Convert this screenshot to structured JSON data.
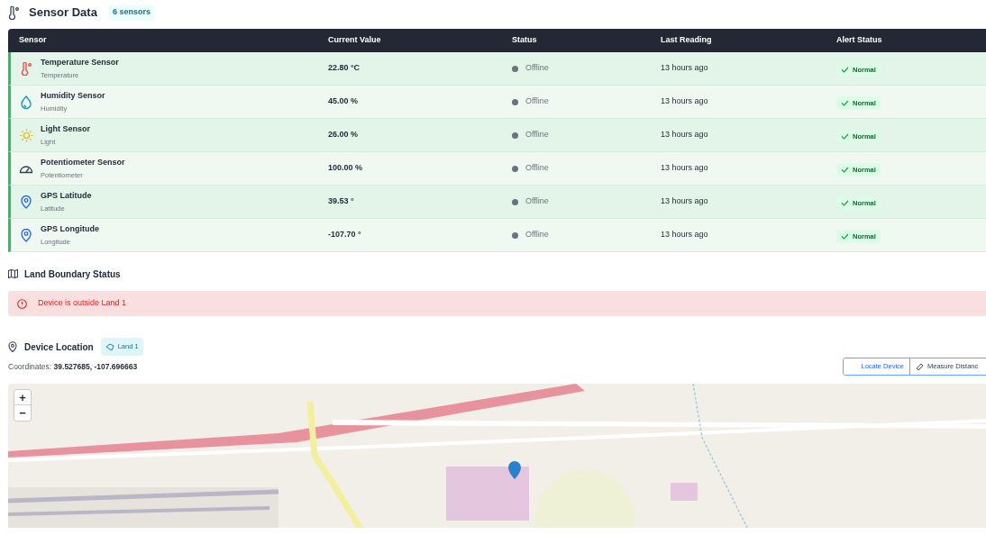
{
  "sensor_section": {
    "title": "Sensor Data",
    "count_badge": "6 sensors"
  },
  "table": {
    "columns": [
      "Sensor",
      "Current Value",
      "Status",
      "Last Reading",
      "Alert Status"
    ],
    "rows": [
      {
        "kind": "temperature",
        "name": "Temperature Sensor",
        "type": "Temperature",
        "value": "22.80 °C",
        "status": "Offline",
        "last_reading": "13 hours ago",
        "alert": "Normal"
      },
      {
        "kind": "humidity",
        "name": "Humidity Sensor",
        "type": "Humidity",
        "value": "45.00 %",
        "status": "Offline",
        "last_reading": "13 hours ago",
        "alert": "Normal"
      },
      {
        "kind": "light",
        "name": "Light Sensor",
        "type": "Light",
        "value": "26.00 %",
        "status": "Offline",
        "last_reading": "13 hours ago",
        "alert": "Normal"
      },
      {
        "kind": "gauge",
        "name": "Potentiometer Sensor",
        "type": "Potentiometer",
        "value": "100.00 %",
        "status": "Offline",
        "last_reading": "13 hours ago",
        "alert": "Normal"
      },
      {
        "kind": "location",
        "name": "GPS Latitude",
        "type": "Latitude",
        "value": "39.53 °",
        "status": "Offline",
        "last_reading": "13 hours ago",
        "alert": "Normal"
      },
      {
        "kind": "location",
        "name": "GPS Longitude",
        "type": "Longitude",
        "value": "-107.70 °",
        "status": "Offline",
        "last_reading": "13 hours ago",
        "alert": "Normal"
      }
    ]
  },
  "boundary_section": {
    "title": "Land Boundary Status",
    "alert": "Device is outside Land 1"
  },
  "location_section": {
    "title": "Device Location",
    "land_badge": "Land 1",
    "coordinates_label": "Coordinates:",
    "coordinates": "39.527685, -107.696663",
    "buttons": [
      "Locate Device",
      "Measure Distanc"
    ],
    "map": {
      "kind": "picture",
      "zoom_in": "+",
      "zoom_out": "−"
    }
  }
}
